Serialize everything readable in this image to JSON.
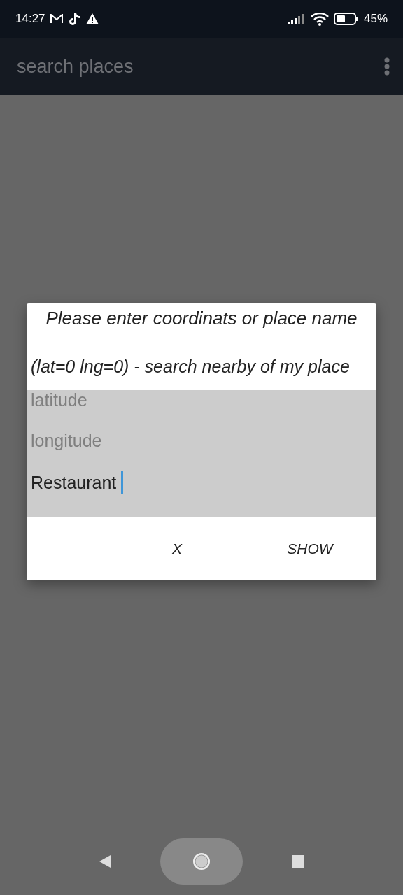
{
  "status_bar": {
    "time": "14:27",
    "battery": "45%"
  },
  "app_bar": {
    "title": "search places"
  },
  "dialog": {
    "title": "Please enter coordinats or place name",
    "message": "(lat=0 lng=0) - search nearby of my place",
    "fields": [
      {
        "placeholder": "latitude",
        "focused": false
      },
      {
        "placeholder": "longitude",
        "focused": false
      },
      {
        "value": "Restaurant",
        "focused": true
      }
    ],
    "buttons": [
      "X",
      "SHOW"
    ]
  }
}
